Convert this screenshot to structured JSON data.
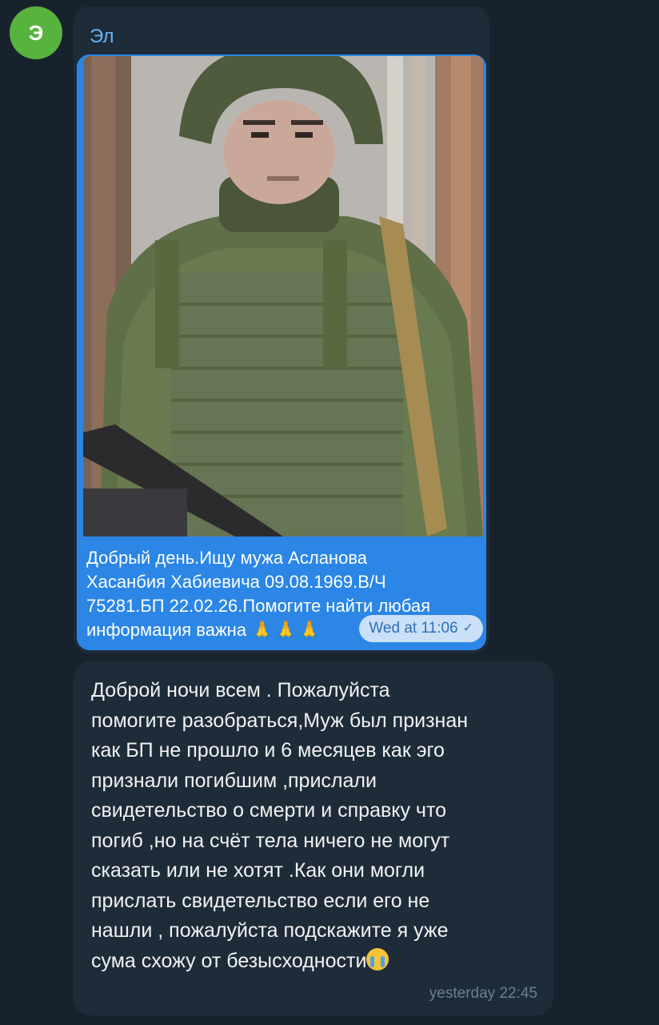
{
  "chat": {
    "avatar_letter": "Э",
    "avatar_color": "#58b33e",
    "background_color": "#18222d",
    "bubble_color": "#1e2c3a",
    "messages": [
      {
        "sender": "Эл",
        "forwarded": {
          "photo_alt": "photo of man in military uniform",
          "caption_lines": [
            "Добрый день.Ищу мужа Асланова",
            "Хасанбия Хабиевича 09.08.1969.В/Ч",
            "75281.БП 22.02.26.Помогите найти любая",
            "информация важна"
          ],
          "caption_emoji": "🙏🙏🙏",
          "time": "Wed at 11:06",
          "status_icon": "double-check-icon"
        }
      },
      {
        "text_lines": [
          "Доброй ночи всем . Пожалуйста",
          "помогите разобраться,Муж был признан",
          "как БП не прошло и 6 месяцев как эго",
          "признали погибшим ,прислали",
          "свидетельство о смерти и справку что",
          "погиб ,но на счёт тела ничего не могут",
          "сказать или не хотят .Как они могли",
          "прислать свидетельство если его не",
          "нашли , пожалуйста подскажите я уже",
          "сума схожу от безысходности"
        ],
        "trailing_emoji": "crying-face-emoji",
        "time": "yesterday 22:45"
      }
    ]
  }
}
